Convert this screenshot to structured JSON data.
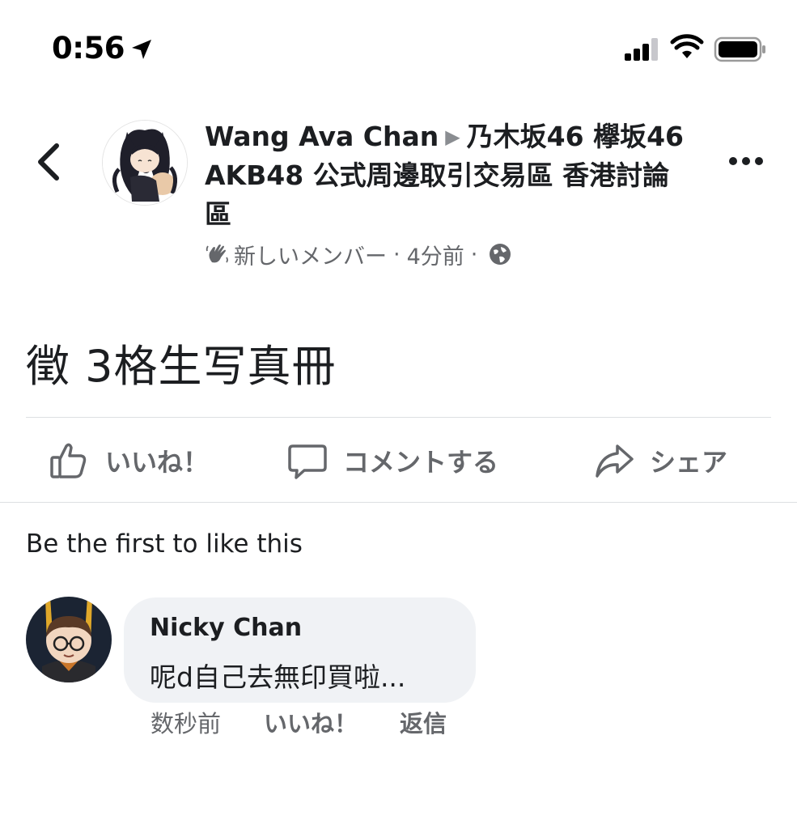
{
  "status_bar": {
    "time": "0:56"
  },
  "post": {
    "author": "Wang Ava Chan",
    "group": "乃木坂46 欅坂46 AKB48 公式周邊取引交易區 香港討論區",
    "badge": "新しいメンバー",
    "dot1": "·",
    "time": "4分前",
    "dot2": "·",
    "text": "徵 3格生写真冊"
  },
  "actions": {
    "like": "いいね！",
    "comment": "コメントする",
    "share": "シェア"
  },
  "likes_summary": "Be the first to like this",
  "comment": {
    "author": "Nicky Chan",
    "text": "呢d自己去無印買啦...",
    "time": "数秒前",
    "like": "いいね！",
    "reply": "返信"
  },
  "colors": {
    "text_primary": "#1c1e21",
    "text_secondary": "#65676b",
    "bubble": "#f0f2f5",
    "divider": "#dddfe2"
  },
  "icons": [
    "location-arrow-icon",
    "signal-icon",
    "wifi-icon",
    "battery-icon",
    "back-chevron-icon",
    "more-dots-icon",
    "wave-hand-icon",
    "globe-icon",
    "thumbs-up-icon",
    "comment-bubble-icon",
    "share-arrow-icon"
  ]
}
